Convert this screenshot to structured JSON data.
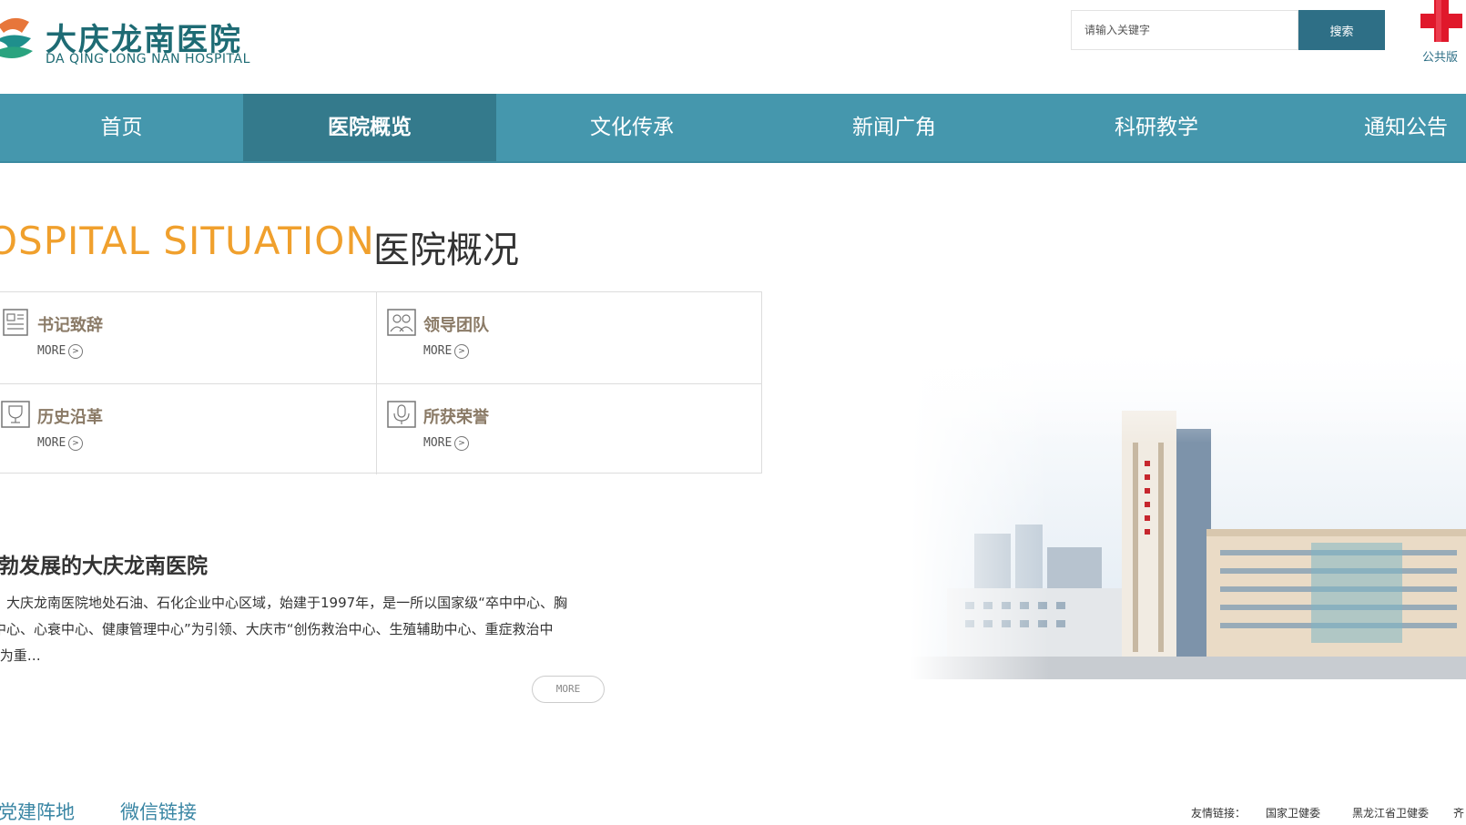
{
  "header": {
    "logo_cn": "大庆龙南医院",
    "logo_en": "DA QING LONG NAN HOSPITAL",
    "search_placeholder": "请输入关键字",
    "search_button": "搜索",
    "public_label": "公共版"
  },
  "nav": {
    "items": [
      {
        "label": "首页"
      },
      {
        "label": "医院概览",
        "active": true
      },
      {
        "label": "文化传承"
      },
      {
        "label": "新闻广角"
      },
      {
        "label": "科研教学"
      },
      {
        "label": "通知公告"
      }
    ]
  },
  "section": {
    "title_en": "OSPITAL SITUATION",
    "title_cn": "医院概况"
  },
  "grid": [
    {
      "title": "书记致辞",
      "more": "MORE",
      "icon": "document-icon"
    },
    {
      "title": "领导团队",
      "more": "MORE",
      "icon": "team-icon"
    },
    {
      "title": "历史沿革",
      "more": "MORE",
      "icon": "trophy-icon"
    },
    {
      "title": "所获荣誉",
      "more": "MORE",
      "icon": "medal-icon"
    }
  ],
  "article": {
    "title": "勃发展的大庆龙南医院",
    "lines": [
      "，大庆龙南医院地处石油、石化企业中心区域，始建于1997年，是一所以国家级“卒中中心、胸",
      "中心、心衰中心、健康管理中心”为引领、大庆市“创伤救治中心、生殖辅助中心、重症救治中",
      "”为重…"
    ],
    "more": "MORE"
  },
  "footer": {
    "links": [
      "党建阵地",
      "微信链接"
    ],
    "friend_label": "友情链接：",
    "friends": [
      "国家卫健委",
      "黑龙江省卫健委",
      "齐"
    ]
  },
  "colors": {
    "nav_bg": "#4597ad",
    "nav_active": "#347a8c",
    "accent_orange": "#f0a02d",
    "brand_teal": "#1e6b74",
    "search_button": "#2e6f86"
  }
}
